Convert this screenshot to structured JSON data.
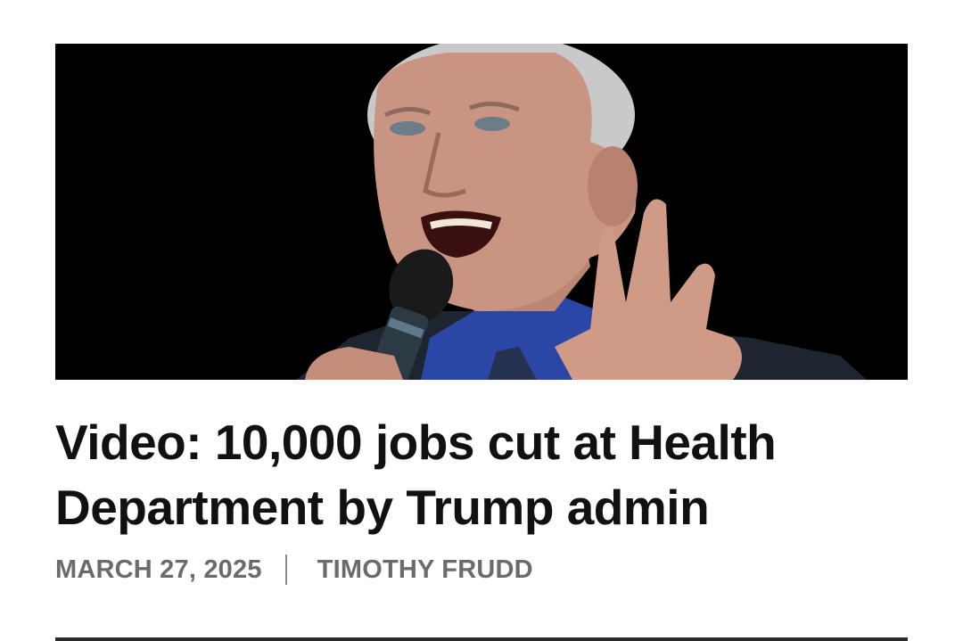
{
  "article": {
    "headline": "Video: 10,000 jobs cut at Health Department by Trump admin",
    "date": "MARCH 27, 2025",
    "author": "TIMOTHY FRUDD"
  },
  "hero_image": {
    "icon": "photo-of-speaker-at-microphone",
    "background_color": "#000000"
  },
  "colors": {
    "headline": "#111111",
    "meta": "#6b6b6b",
    "divider": "#8a8a8a"
  }
}
